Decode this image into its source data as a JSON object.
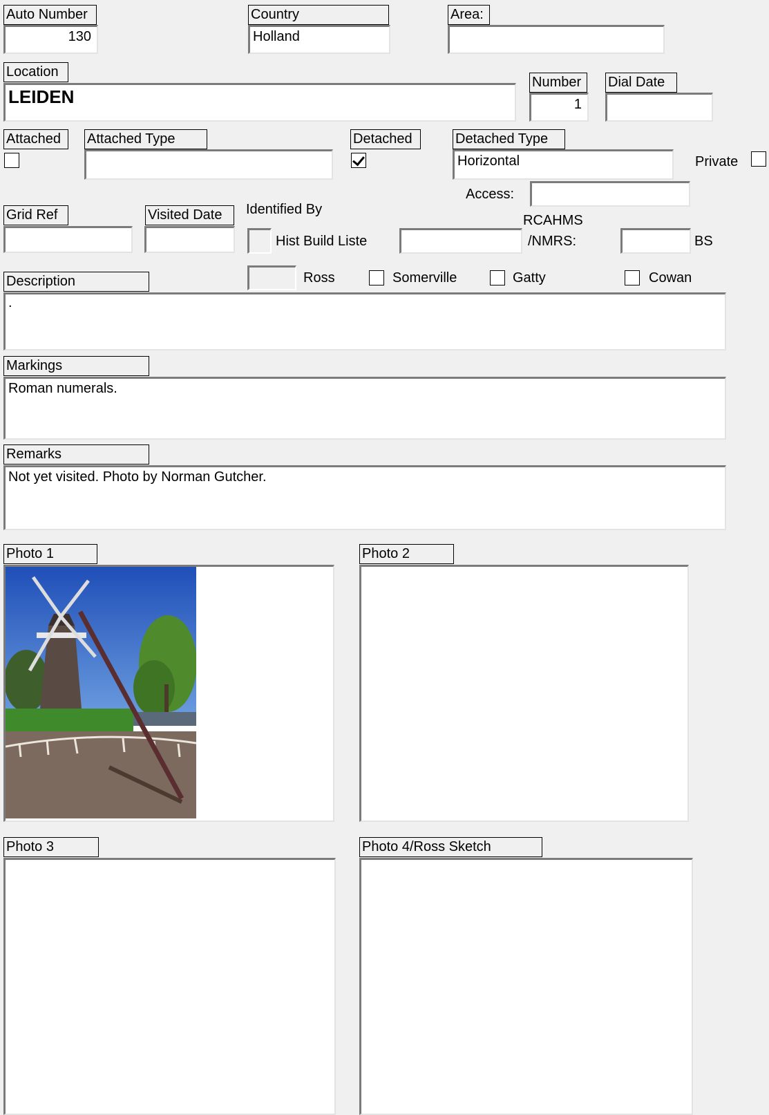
{
  "record": {
    "auto_number": {
      "label": "Auto Number",
      "value": "130"
    },
    "country": {
      "label": "Country",
      "value": "Holland"
    },
    "area": {
      "label": "Area:",
      "value": ""
    },
    "location": {
      "label": "Location",
      "value": "LEIDEN"
    },
    "number": {
      "label": "Number",
      "value": "1"
    },
    "dial_date": {
      "label": "Dial Date",
      "value": ""
    },
    "attached": {
      "label": "Attached",
      "checked": false
    },
    "attached_type": {
      "label": "Attached Type",
      "value": ""
    },
    "detached": {
      "label": "Detached",
      "checked": true
    },
    "detached_type": {
      "label": "Detached Type",
      "value": "Horizontal"
    },
    "private": {
      "label": "Private",
      "checked": false
    },
    "access": {
      "label": "Access:",
      "value": ""
    },
    "grid_ref": {
      "label": "Grid Ref",
      "value": ""
    },
    "visited_date": {
      "label": "Visited Date",
      "value": ""
    },
    "identified_by": {
      "label": "Identified By",
      "hist_build_liste": {
        "label": "Hist Build Liste",
        "value": ""
      },
      "rcahms_line1": "RCAHMS",
      "rcahms_line2": "/NMRS:",
      "rcahms_value": "",
      "bs": {
        "label": "BS"
      },
      "ross": {
        "label": "Ross"
      },
      "somerville": {
        "label": "Somerville",
        "checked": false
      },
      "gatty": {
        "label": "Gatty",
        "checked": false
      },
      "cowan": {
        "label": "Cowan",
        "checked": false
      }
    },
    "description": {
      "label": "Description",
      "value": "."
    },
    "markings": {
      "label": "Markings",
      "value": "Roman numerals."
    },
    "remarks": {
      "label": "Remarks",
      "value": "Not yet visited.  Photo by Norman Gutcher."
    },
    "photos": {
      "photo1": {
        "label": "Photo 1"
      },
      "photo2": {
        "label": "Photo 2"
      },
      "photo3": {
        "label": "Photo 3"
      },
      "photo4": {
        "label": "Photo 4/Ross Sketch"
      }
    }
  }
}
